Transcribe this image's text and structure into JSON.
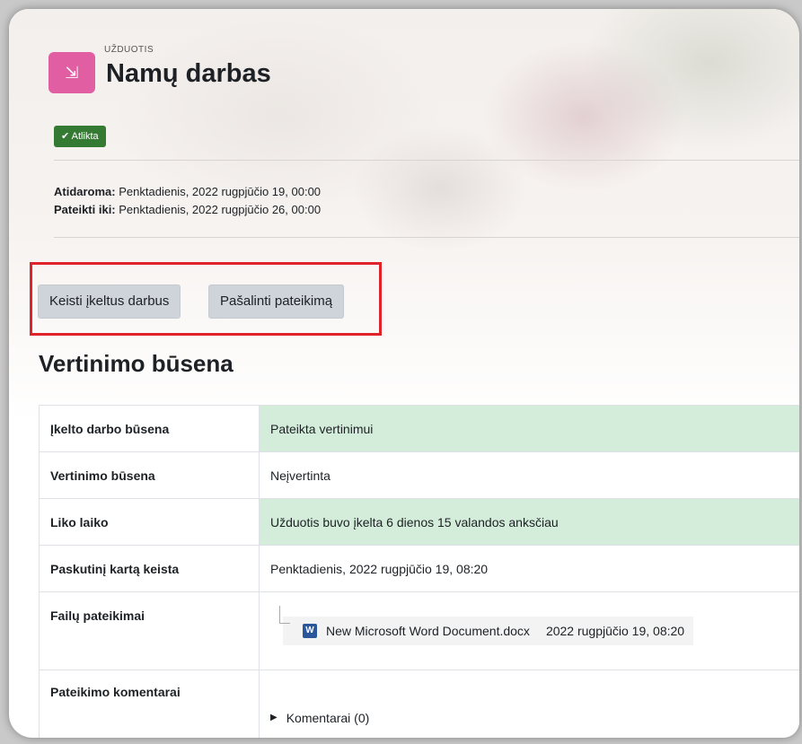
{
  "header": {
    "module_kind": "UŽDUOTIS",
    "title": "Namų darbas",
    "completion_badge": "✔ Atlikta"
  },
  "dates": {
    "opened_label": "Atidaroma:",
    "opened_value": "Penktadienis, 2022 rugpjūčio 19, 00:00",
    "due_label": "Pateikti iki:",
    "due_value": "Penktadienis, 2022 rugpjūčio 26, 00:00"
  },
  "actions": {
    "edit_label": "Keisti įkeltus darbus",
    "remove_label": "Pašalinti pateikimą"
  },
  "status_section": {
    "title": "Vertinimo būsena",
    "rows": [
      {
        "label": "Įkelto darbo būsena",
        "value": "Pateikta vertinimui"
      },
      {
        "label": "Vertinimo būsena",
        "value": "Neįvertinta"
      },
      {
        "label": "Liko laiko",
        "value": "Užduotis buvo įkelta 6 dienos 15 valandos anksčiau"
      },
      {
        "label": "Paskutinį kartą keista",
        "value": "Penktadienis, 2022 rugpjūčio 19, 08:20"
      },
      {
        "label": "Failų pateikimai",
        "file_name": "New Microsoft Word Document.docx",
        "file_date": "2022 rugpjūčio 19, 08:20"
      },
      {
        "label": "Pateikimo komentarai",
        "toggle": "Komentarai (0)"
      }
    ]
  },
  "colors": {
    "success_bg": "#d4edda",
    "badge_green": "#357a32",
    "highlight_red": "#e0232b",
    "module_icon": "#e25ea3",
    "button_bg": "#ced4da"
  },
  "icons": {
    "module": "assignment-icon",
    "file": "word-document-icon",
    "toggle": "caret-right-icon"
  }
}
